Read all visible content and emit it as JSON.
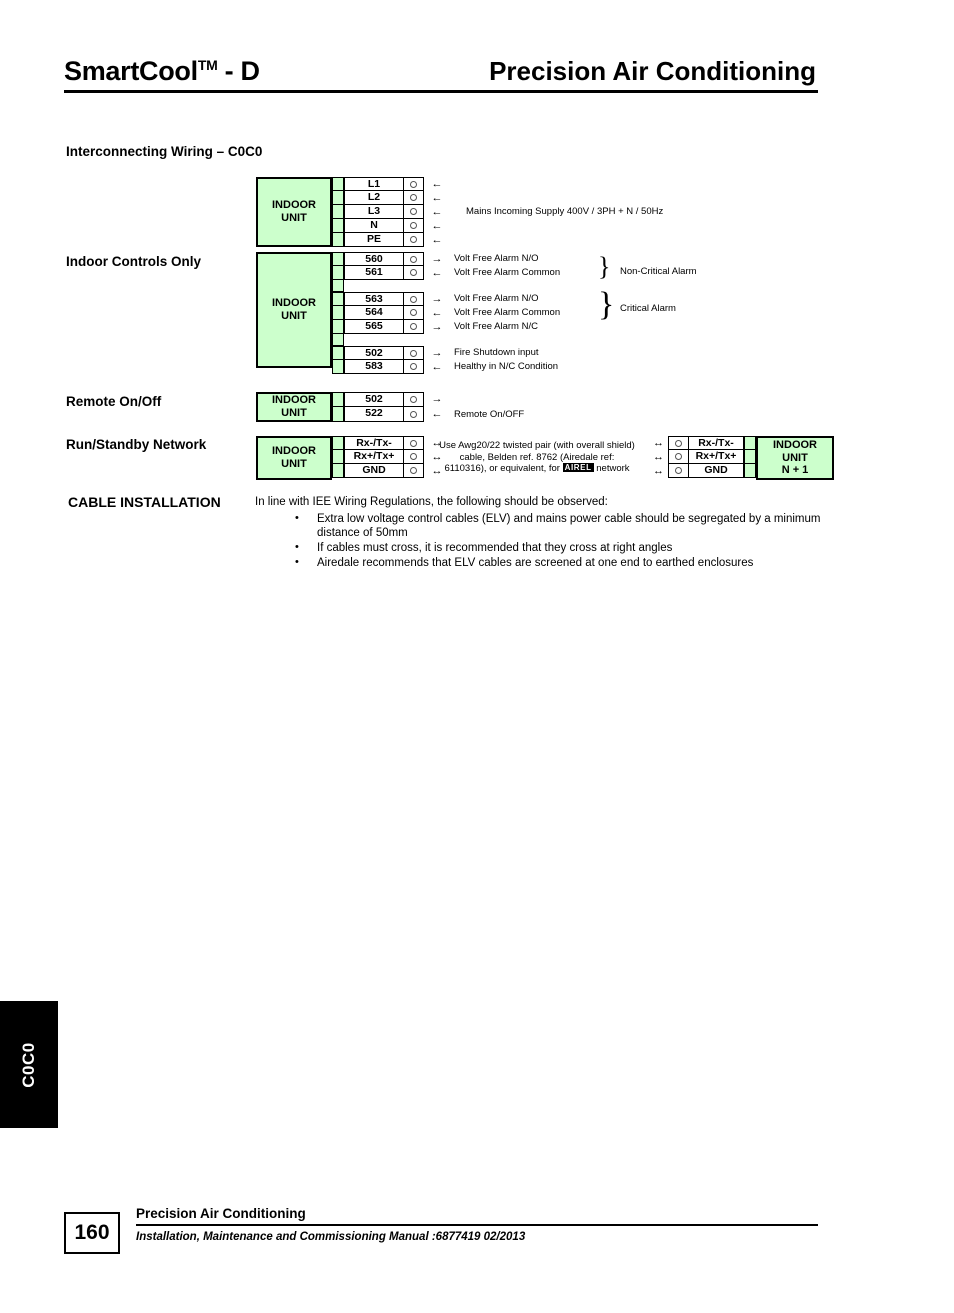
{
  "header": {
    "brand": "SmartCool",
    "brand_sup": "TM",
    "brand_suffix": " - D",
    "right_title": "Precision Air Conditioning"
  },
  "sections": {
    "interconnecting": "Interconnecting Wiring – C0C0",
    "indoor_controls": "Indoor Controls Only",
    "remote_onoff": "Remote On/Off",
    "run_standby": "Run/Standby Network"
  },
  "unit_labels": {
    "indoor_line1": "INDOOR",
    "indoor_line2": "UNIT",
    "indoor_n1_line3": "N + 1"
  },
  "mains_block": {
    "rows": [
      {
        "terminal": "L1",
        "arrow": "←"
      },
      {
        "terminal": "L2",
        "arrow": "←"
      },
      {
        "terminal": "L3",
        "arrow": "←"
      },
      {
        "terminal": "N",
        "arrow": "←"
      },
      {
        "terminal": "PE",
        "arrow": "←"
      }
    ],
    "description": "Mains Incoming Supply 400V / 3PH + N / 50Hz"
  },
  "controls_block": {
    "rows": [
      {
        "terminal": "560",
        "arrow": "→",
        "description": "Volt Free Alarm N/O"
      },
      {
        "terminal": "561",
        "arrow": "←",
        "description": "Volt Free Alarm Common"
      },
      {
        "terminal": "",
        "arrow": "",
        "description": ""
      },
      {
        "terminal": "563",
        "arrow": "→",
        "description": "Volt Free Alarm N/O"
      },
      {
        "terminal": "564",
        "arrow": "←",
        "description": "Volt Free Alarm Common"
      },
      {
        "terminal": "565",
        "arrow": "→",
        "description": "Volt Free Alarm N/C"
      },
      {
        "terminal": "",
        "arrow": "",
        "description": ""
      },
      {
        "terminal": "502",
        "arrow": "→",
        "description": "Fire Shutdown input"
      },
      {
        "terminal": "583",
        "arrow": "←",
        "description": "Healthy in N/C Condition"
      }
    ],
    "groups": [
      {
        "label": "Non-Critical Alarm"
      },
      {
        "label": "Critical Alarm"
      }
    ]
  },
  "remote_block": {
    "rows": [
      {
        "terminal": "502",
        "arrow": "→"
      },
      {
        "terminal": "522",
        "arrow": "←"
      }
    ],
    "description": "Remote On/OFF"
  },
  "network_block": {
    "rows": [
      {
        "terminal": "Rx-/Tx-",
        "arrow": "↔"
      },
      {
        "terminal": "Rx+/Tx+",
        "arrow": "↔"
      },
      {
        "terminal": "GND",
        "arrow": "↔"
      }
    ],
    "note_line1": "Use Awg20/22 twisted pair (with overall shield)",
    "note_line2": "cable, Belden ref. 8762 (Airedale ref:",
    "note_line3_pre": "6110316), or equivalent, for",
    "note_logo": "AIREL",
    "note_line3_post": "network"
  },
  "cable_installation": {
    "title": "CABLE INSTALLATION",
    "intro": "In line with IEE Wiring Regulations, the following should be observed:",
    "bullets": [
      "Extra low voltage control cables (ELV) and mains power cable should be segregated by a minimum distance of 50mm",
      "If cables must cross, it is recommended that they cross at right angles",
      "Airedale recommends that ELV cables are screened at one end to earthed enclosures"
    ]
  },
  "side_tab": {
    "label": "C0C0"
  },
  "footer": {
    "page_number": "160",
    "title": "Precision Air Conditioning",
    "subtitle": "Installation, Maintenance and Commissioning Manual :6877419 02/2013"
  },
  "colors": {
    "unit_green": "#CCFFCC",
    "ink": "#000000"
  }
}
